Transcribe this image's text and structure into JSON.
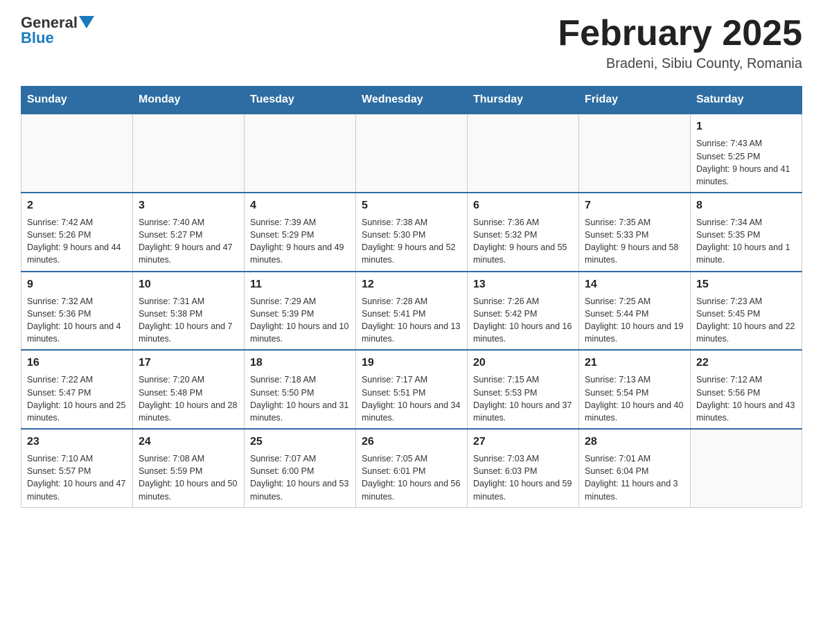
{
  "header": {
    "logo_general": "General",
    "logo_blue": "Blue",
    "title": "February 2025",
    "location": "Bradeni, Sibiu County, Romania"
  },
  "days_of_week": [
    "Sunday",
    "Monday",
    "Tuesday",
    "Wednesday",
    "Thursday",
    "Friday",
    "Saturday"
  ],
  "weeks": [
    [
      {
        "day": "",
        "info": ""
      },
      {
        "day": "",
        "info": ""
      },
      {
        "day": "",
        "info": ""
      },
      {
        "day": "",
        "info": ""
      },
      {
        "day": "",
        "info": ""
      },
      {
        "day": "",
        "info": ""
      },
      {
        "day": "1",
        "info": "Sunrise: 7:43 AM\nSunset: 5:25 PM\nDaylight: 9 hours and 41 minutes."
      }
    ],
    [
      {
        "day": "2",
        "info": "Sunrise: 7:42 AM\nSunset: 5:26 PM\nDaylight: 9 hours and 44 minutes."
      },
      {
        "day": "3",
        "info": "Sunrise: 7:40 AM\nSunset: 5:27 PM\nDaylight: 9 hours and 47 minutes."
      },
      {
        "day": "4",
        "info": "Sunrise: 7:39 AM\nSunset: 5:29 PM\nDaylight: 9 hours and 49 minutes."
      },
      {
        "day": "5",
        "info": "Sunrise: 7:38 AM\nSunset: 5:30 PM\nDaylight: 9 hours and 52 minutes."
      },
      {
        "day": "6",
        "info": "Sunrise: 7:36 AM\nSunset: 5:32 PM\nDaylight: 9 hours and 55 minutes."
      },
      {
        "day": "7",
        "info": "Sunrise: 7:35 AM\nSunset: 5:33 PM\nDaylight: 9 hours and 58 minutes."
      },
      {
        "day": "8",
        "info": "Sunrise: 7:34 AM\nSunset: 5:35 PM\nDaylight: 10 hours and 1 minute."
      }
    ],
    [
      {
        "day": "9",
        "info": "Sunrise: 7:32 AM\nSunset: 5:36 PM\nDaylight: 10 hours and 4 minutes."
      },
      {
        "day": "10",
        "info": "Sunrise: 7:31 AM\nSunset: 5:38 PM\nDaylight: 10 hours and 7 minutes."
      },
      {
        "day": "11",
        "info": "Sunrise: 7:29 AM\nSunset: 5:39 PM\nDaylight: 10 hours and 10 minutes."
      },
      {
        "day": "12",
        "info": "Sunrise: 7:28 AM\nSunset: 5:41 PM\nDaylight: 10 hours and 13 minutes."
      },
      {
        "day": "13",
        "info": "Sunrise: 7:26 AM\nSunset: 5:42 PM\nDaylight: 10 hours and 16 minutes."
      },
      {
        "day": "14",
        "info": "Sunrise: 7:25 AM\nSunset: 5:44 PM\nDaylight: 10 hours and 19 minutes."
      },
      {
        "day": "15",
        "info": "Sunrise: 7:23 AM\nSunset: 5:45 PM\nDaylight: 10 hours and 22 minutes."
      }
    ],
    [
      {
        "day": "16",
        "info": "Sunrise: 7:22 AM\nSunset: 5:47 PM\nDaylight: 10 hours and 25 minutes."
      },
      {
        "day": "17",
        "info": "Sunrise: 7:20 AM\nSunset: 5:48 PM\nDaylight: 10 hours and 28 minutes."
      },
      {
        "day": "18",
        "info": "Sunrise: 7:18 AM\nSunset: 5:50 PM\nDaylight: 10 hours and 31 minutes."
      },
      {
        "day": "19",
        "info": "Sunrise: 7:17 AM\nSunset: 5:51 PM\nDaylight: 10 hours and 34 minutes."
      },
      {
        "day": "20",
        "info": "Sunrise: 7:15 AM\nSunset: 5:53 PM\nDaylight: 10 hours and 37 minutes."
      },
      {
        "day": "21",
        "info": "Sunrise: 7:13 AM\nSunset: 5:54 PM\nDaylight: 10 hours and 40 minutes."
      },
      {
        "day": "22",
        "info": "Sunrise: 7:12 AM\nSunset: 5:56 PM\nDaylight: 10 hours and 43 minutes."
      }
    ],
    [
      {
        "day": "23",
        "info": "Sunrise: 7:10 AM\nSunset: 5:57 PM\nDaylight: 10 hours and 47 minutes."
      },
      {
        "day": "24",
        "info": "Sunrise: 7:08 AM\nSunset: 5:59 PM\nDaylight: 10 hours and 50 minutes."
      },
      {
        "day": "25",
        "info": "Sunrise: 7:07 AM\nSunset: 6:00 PM\nDaylight: 10 hours and 53 minutes."
      },
      {
        "day": "26",
        "info": "Sunrise: 7:05 AM\nSunset: 6:01 PM\nDaylight: 10 hours and 56 minutes."
      },
      {
        "day": "27",
        "info": "Sunrise: 7:03 AM\nSunset: 6:03 PM\nDaylight: 10 hours and 59 minutes."
      },
      {
        "day": "28",
        "info": "Sunrise: 7:01 AM\nSunset: 6:04 PM\nDaylight: 11 hours and 3 minutes."
      },
      {
        "day": "",
        "info": ""
      }
    ]
  ]
}
